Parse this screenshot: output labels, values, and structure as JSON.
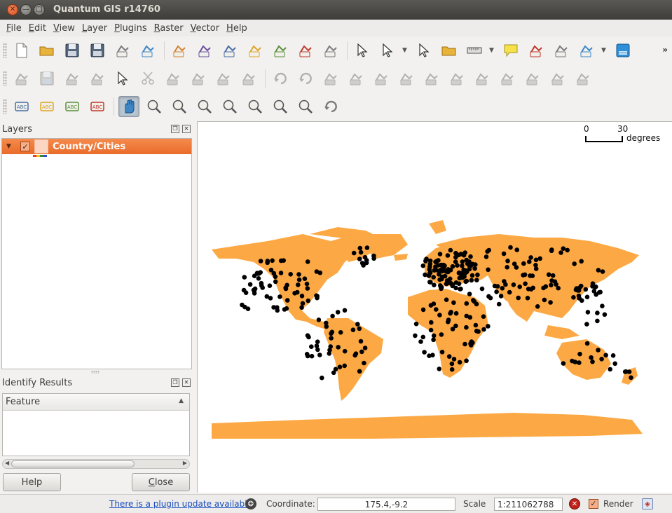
{
  "window": {
    "title": "Quantum GIS r14760"
  },
  "menu": {
    "items": [
      {
        "label_ul": "F",
        "label_rest": "ile"
      },
      {
        "label_ul": "E",
        "label_rest": "dit"
      },
      {
        "label_ul": "V",
        "label_rest": "iew"
      },
      {
        "label_ul": "L",
        "label_rest": "ayer"
      },
      {
        "label_ul": "P",
        "label_rest": "lugins"
      },
      {
        "label_ul": "R",
        "label_rest": "aster"
      },
      {
        "label_ul": "V",
        "label_rest": "ector"
      },
      {
        "label_ul": "H",
        "label_rest": "elp"
      }
    ]
  },
  "layers_panel": {
    "title": "Layers",
    "layer": {
      "name": "Country/Cities",
      "checked": true,
      "fill_color": "#fbd6c3"
    }
  },
  "identify_panel": {
    "title": "Identify Results",
    "column_header": "Feature",
    "help_label": "Help",
    "close_label_ul": "C",
    "close_label_rest": "lose"
  },
  "map": {
    "land_color": "#fca945",
    "city_color": "#000000",
    "scalebar": {
      "start": "0",
      "end": "30",
      "units": "degrees"
    }
  },
  "status_bar": {
    "plugin_update_text": "There is a plugin update available",
    "coordinate_label": "Coordinate:",
    "coordinate_value": "175.4,-9.2",
    "scale_label": "Scale",
    "scale_value": "1:211062788",
    "render_label": "Render",
    "render_checked": true
  },
  "icons": {
    "toolbar1": [
      "new-project-icon",
      "open-project-icon",
      "save-project-icon",
      "save-as-icon",
      "print-composer-icon",
      "composer-manager-icon",
      "new-vector-layer-icon",
      "add-vector-layer-icon",
      "add-raster-layer-icon",
      "add-postgis-icon",
      "add-spatialite-icon",
      "add-wms-icon",
      "remove-layer-icon",
      "identify-icon",
      "select-features-icon",
      "deselect-icon",
      "open-attribute-table-icon",
      "measure-line-icon",
      "map-tips-icon",
      "new-bookmark-icon",
      "show-bookmarks-icon",
      "text-annotation-icon",
      "help-contents-icon"
    ],
    "toolbar2": [
      "toggle-editing-icon",
      "save-edits-icon",
      "add-feature-icon",
      "move-feature-icon",
      "delete-selected-icon",
      "cut-features-icon",
      "copy-features-icon",
      "paste-features-icon",
      "node-tool-icon",
      "simplify-feature-icon",
      "undo-icon",
      "redo-icon",
      "add-ring-icon",
      "add-part-icon",
      "fill-ring-icon",
      "delete-ring-icon",
      "delete-part-icon",
      "reshape-features-icon",
      "offset-curve-icon",
      "split-features-icon",
      "merge-features-icon",
      "merge-attributes-icon",
      "rotate-point-symbols-icon"
    ],
    "toolbar3": [
      "label-icon",
      "move-label-icon",
      "rotate-label-icon",
      "change-label-icon",
      "pan-map-icon",
      "zoom-in-icon",
      "zoom-out-icon",
      "zoom-full-icon",
      "zoom-to-selection-icon",
      "zoom-to-layer-icon",
      "zoom-last-icon",
      "zoom-next-icon",
      "refresh-icon"
    ]
  }
}
